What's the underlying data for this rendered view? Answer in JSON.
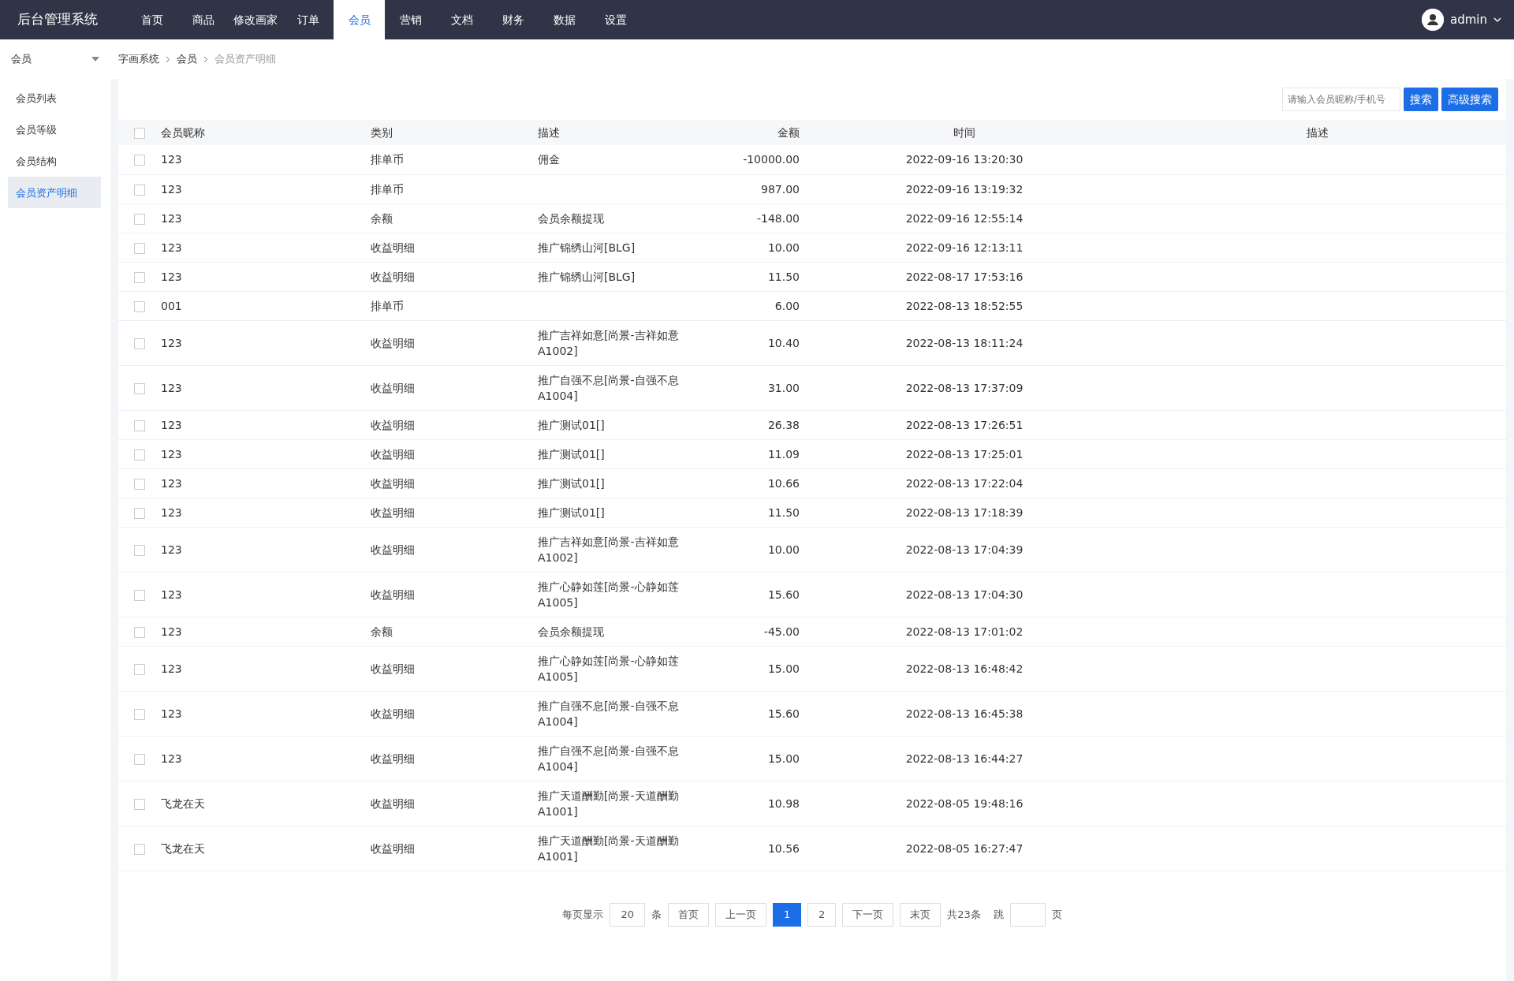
{
  "app": {
    "title": "后台管理系统",
    "user": "admin"
  },
  "nav": [
    {
      "label": "首页",
      "selected": false
    },
    {
      "label": "商品",
      "selected": false
    },
    {
      "label": "修改画家",
      "selected": false
    },
    {
      "label": "订单",
      "selected": false
    },
    {
      "label": "会员",
      "selected": true
    },
    {
      "label": "营销",
      "selected": false
    },
    {
      "label": "文档",
      "selected": false
    },
    {
      "label": "财务",
      "selected": false
    },
    {
      "label": "数据",
      "selected": false
    },
    {
      "label": "设置",
      "selected": false
    }
  ],
  "sidebar": {
    "section": "会员",
    "items": [
      {
        "label": "会员列表",
        "selected": false
      },
      {
        "label": "会员等级",
        "selected": false
      },
      {
        "label": "会员结构",
        "selected": false
      },
      {
        "label": "会员资产明细",
        "selected": true
      }
    ]
  },
  "breadcrumb": [
    "字画系统",
    "会员",
    "会员资产明细"
  ],
  "search": {
    "placeholder": "请输入会员昵称/手机号",
    "buttons": [
      "搜索",
      "高级搜索"
    ]
  },
  "table": {
    "all_checked": false,
    "columns": [
      "会员昵称",
      "类别",
      "描述",
      "金额",
      "时间",
      "描述"
    ],
    "rows": [
      {
        "checked": false,
        "cells": [
          "123",
          "排单币",
          "佣金",
          "-10000.00",
          "2022-09-16 13:20:30",
          ""
        ]
      },
      {
        "checked": false,
        "cells": [
          "123",
          "排单币",
          "",
          "987.00",
          "2022-09-16 13:19:32",
          ""
        ]
      },
      {
        "checked": false,
        "cells": [
          "123",
          "余额",
          "会员余额提现",
          "-148.00",
          "2022-09-16 12:55:14",
          ""
        ]
      },
      {
        "checked": false,
        "cells": [
          "123",
          "收益明细",
          "推广锦绣山河[BLG]",
          "10.00",
          "2022-09-16 12:13:11",
          ""
        ]
      },
      {
        "checked": false,
        "cells": [
          "123",
          "收益明细",
          "推广锦绣山河[BLG]",
          "11.50",
          "2022-08-17 17:53:16",
          ""
        ]
      },
      {
        "checked": false,
        "cells": [
          "001",
          "排单币",
          "",
          "6.00",
          "2022-08-13 18:52:55",
          ""
        ]
      },
      {
        "checked": false,
        "cells": [
          "123",
          "收益明细",
          "推广吉祥如意[尚景-吉祥如意A1002]",
          "10.40",
          "2022-08-13 18:11:24",
          ""
        ]
      },
      {
        "checked": false,
        "cells": [
          "123",
          "收益明细",
          "推广自强不息[尚景-自强不息A1004]",
          "31.00",
          "2022-08-13 17:37:09",
          ""
        ]
      },
      {
        "checked": false,
        "cells": [
          "123",
          "收益明细",
          "推广测试01[]",
          "26.38",
          "2022-08-13 17:26:51",
          ""
        ]
      },
      {
        "checked": false,
        "cells": [
          "123",
          "收益明细",
          "推广测试01[]",
          "11.09",
          "2022-08-13 17:25:01",
          ""
        ]
      },
      {
        "checked": false,
        "cells": [
          "123",
          "收益明细",
          "推广测试01[]",
          "10.66",
          "2022-08-13 17:22:04",
          ""
        ]
      },
      {
        "checked": false,
        "cells": [
          "123",
          "收益明细",
          "推广测试01[]",
          "11.50",
          "2022-08-13 17:18:39",
          ""
        ]
      },
      {
        "checked": false,
        "cells": [
          "123",
          "收益明细",
          "推广吉祥如意[尚景-吉祥如意A1002]",
          "10.00",
          "2022-08-13 17:04:39",
          ""
        ]
      },
      {
        "checked": false,
        "cells": [
          "123",
          "收益明细",
          "推广心静如莲[尚景-心静如莲A1005]",
          "15.60",
          "2022-08-13 17:04:30",
          ""
        ]
      },
      {
        "checked": false,
        "cells": [
          "123",
          "余额",
          "会员余额提现",
          "-45.00",
          "2022-08-13 17:01:02",
          ""
        ]
      },
      {
        "checked": false,
        "cells": [
          "123",
          "收益明细",
          "推广心静如莲[尚景-心静如莲A1005]",
          "15.00",
          "2022-08-13 16:48:42",
          ""
        ]
      },
      {
        "checked": false,
        "cells": [
          "123",
          "收益明细",
          "推广自强不息[尚景-自强不息A1004]",
          "15.60",
          "2022-08-13 16:45:38",
          ""
        ]
      },
      {
        "checked": false,
        "cells": [
          "123",
          "收益明细",
          "推广自强不息[尚景-自强不息A1004]",
          "15.00",
          "2022-08-13 16:44:27",
          ""
        ]
      },
      {
        "checked": false,
        "cells": [
          "飞龙在天",
          "收益明细",
          "推广天道酬勤[尚景-天道酬勤A1001]",
          "10.98",
          "2022-08-05 19:48:16",
          ""
        ]
      },
      {
        "checked": false,
        "cells": [
          "飞龙在天",
          "收益明细",
          "推广天道酬勤[尚景-天道酬勤A1001]",
          "10.56",
          "2022-08-05 16:27:47",
          ""
        ]
      }
    ]
  },
  "pagination": {
    "per_page_label": "每页显示",
    "per_page": "20",
    "per_page_unit": "条",
    "buttons": [
      {
        "label": "首页",
        "selected": false
      },
      {
        "label": "上一页",
        "selected": false
      },
      {
        "label": "1",
        "selected": true
      },
      {
        "label": "2",
        "selected": false
      },
      {
        "label": "下一页",
        "selected": false
      },
      {
        "label": "末页",
        "selected": false
      }
    ],
    "total": "共23条",
    "jump_label": "跳",
    "jump_unit": "页"
  }
}
